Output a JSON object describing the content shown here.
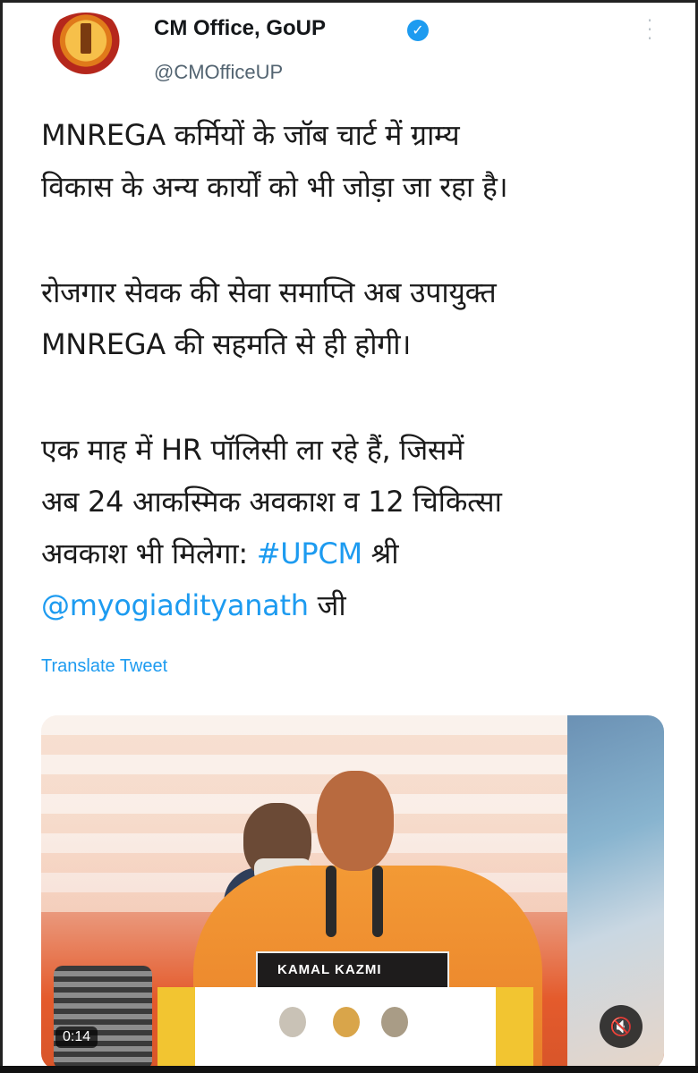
{
  "header": {
    "display_name": "CM Office, GoUP",
    "handle": "@CMOfficeUP",
    "verified_icon": "verified-badge-icon",
    "more_icon": "more-vertical-icon"
  },
  "tweet": {
    "paragraph_1": "MNREGA कर्मियों के जॉब चार्ट में ग्राम्य\nविकास के अन्य कार्यों को भी जोड़ा जा रहा है।",
    "paragraph_2": "रोजगार सेवक की सेवा समाप्ति अब उपायुक्त\nMNREGA की सहमति से ही होगी।",
    "paragraph_3_part1": "एक माह में HR पॉलिसी ला रहे हैं, जिसमें\nअब 24 आकस्मिक अवकाश व 12 चिकित्सा\nअवकाश भी मिलेगा: ",
    "hashtag": "#UPCM",
    "paragraph_3_part2": " श्री\n",
    "mention": "@myogiadityanath",
    "paragraph_3_part3": " जी",
    "translate_label": "Translate Tweet"
  },
  "media": {
    "nameplate_line": "KAMAL  KAZMI",
    "duration": "0:14",
    "mute_icon": "speaker-muted-icon"
  },
  "colors": {
    "link": "#1d9bf0",
    "text": "#1a1a1a",
    "handle": "#536471"
  }
}
